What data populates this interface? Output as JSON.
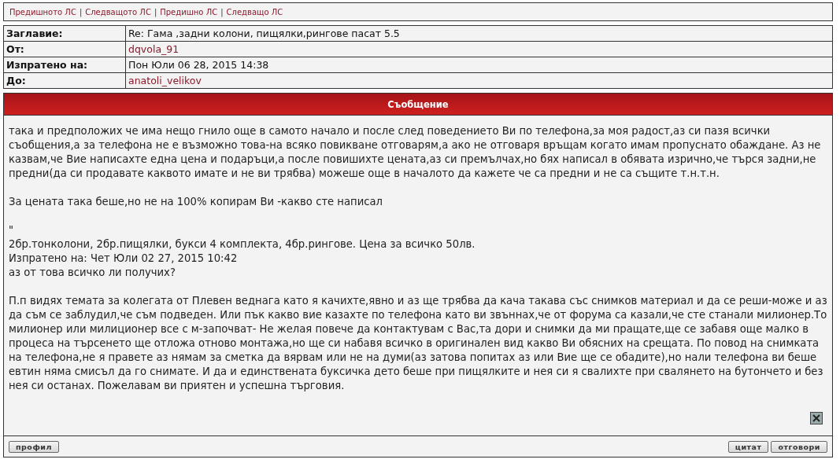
{
  "nav_links": [
    "Предишното ЛС",
    "Следващото ЛС",
    "Предишно ЛС",
    "Следващо ЛС"
  ],
  "nav_separator": "|",
  "header_rows": [
    {
      "label": "Заглавие:",
      "value": "Re: Гама ,задни колони, пищялки,рингове пасат 5.5",
      "kind": "text"
    },
    {
      "label": "От:",
      "value": "dqvola_91",
      "kind": "link"
    },
    {
      "label": "Изпратено на:",
      "value": "Пон Юли 06 28, 2015 14:38",
      "kind": "text"
    },
    {
      "label": "До:",
      "value": "anatoli_velikov",
      "kind": "link"
    }
  ],
  "message": {
    "title": "Съобщение",
    "paragraphs": [
      [
        "така и предположих че има нещо гнило още в самото начало и после след поведението Ви по телефона,за моя радост,аз си пазя всички съобщения,а за телефона не е възможно това-на всяко повикване отговарям,а ако не отговаря връщам когато имам пропуснато обаждане. Аз не казвам,че Вие написахте една цена и подаръци,а после повишихте цената,аз си премълчах,но бях написал в обявата изрично,че търся задни,не предни(да си продавате каквото имате и не ви трябва) можеше още в началото да кажете че са предни и не са същите т.н.т.н."
      ],
      [
        "За цената така беше,но не на 100% копирам Ви -какво сте написал"
      ],
      [
        "\"",
        "2бр.тонколони, 2бр.пищялки, букси 4 комплекта, 4бр.рингове. Цена за всичко 50лв.",
        "Изпратено на: Чет Юли 02 27, 2015 10:42",
        "аз от това всичко ли получих?"
      ],
      [
        "П.п видях темата за колегата от Плевен веднага като я качихте,явно и аз ще трябва да кача такава със снимков материал и да се реши-може и аз да съм се заблудил,че съм подведен. Или пък какво вие казахте по телефона като ви звъннах,че от форума са казали,че сте станали милионер.То милионер или милиционер все с м-започват- Не желая повече да контактувам с Вас,та дори и снимки да ми пращате,ще се забавя още малко в процеса на търсенето ще отложа отново монтажа,но ще си набавя всичко в оригинален вид какво Ви обясних на срещата. По повод на снимката на телефона,не я правете аз нямам за сметка да вярвам или не на думи(аз затова попитах аз или Вие ще се обадите),но нали телефона ви беше евтин няма смисъл да го снимате. И да и единствената буксичка дето беше при пищялките и нея си я свалихте при свалянето на бутончето и без нея си останах. Пожелавам ви приятен и успешна търговия."
      ]
    ]
  },
  "footer_left": [
    "профил"
  ],
  "footer_right": [
    "цитат",
    "отговори"
  ]
}
